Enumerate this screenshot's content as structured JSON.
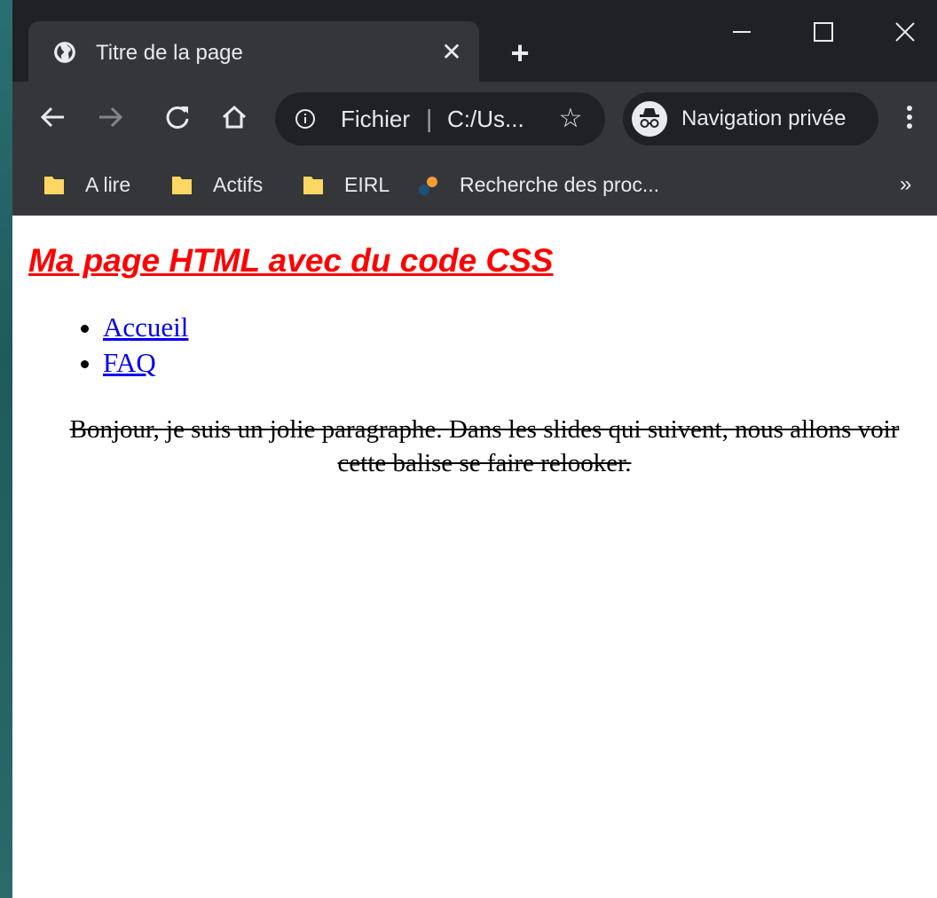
{
  "browser": {
    "tab": {
      "title": "Titre de la page",
      "favicon": "globe-icon"
    },
    "toolbar": {
      "omnibox": {
        "scheme_label": "Fichier",
        "separator": "|",
        "url": "C:/Us..."
      },
      "incognito_label": "Navigation privée"
    },
    "bookmarks": [
      {
        "label": "A lire",
        "icon": "folder-icon"
      },
      {
        "label": "Actifs",
        "icon": "folder-icon"
      },
      {
        "label": "EIRL",
        "icon": "folder-icon"
      },
      {
        "label": "Recherche des proc...",
        "icon": "site-icon"
      }
    ],
    "bookmarks_more": "»"
  },
  "page": {
    "heading": "Ma page HTML avec du code CSS",
    "nav_links": [
      "Accueil",
      "FAQ"
    ],
    "paragraph": "Bonjour, je suis un jolie paragraphe. Dans les slides qui suivent, nous allons voir cette balise se faire relooker."
  },
  "colors": {
    "heading": "#ff0000",
    "link": "#0000ee",
    "chrome_dark": "#202124",
    "chrome_toolbar": "#35363a",
    "bookmark_folder": "#fdd663"
  }
}
